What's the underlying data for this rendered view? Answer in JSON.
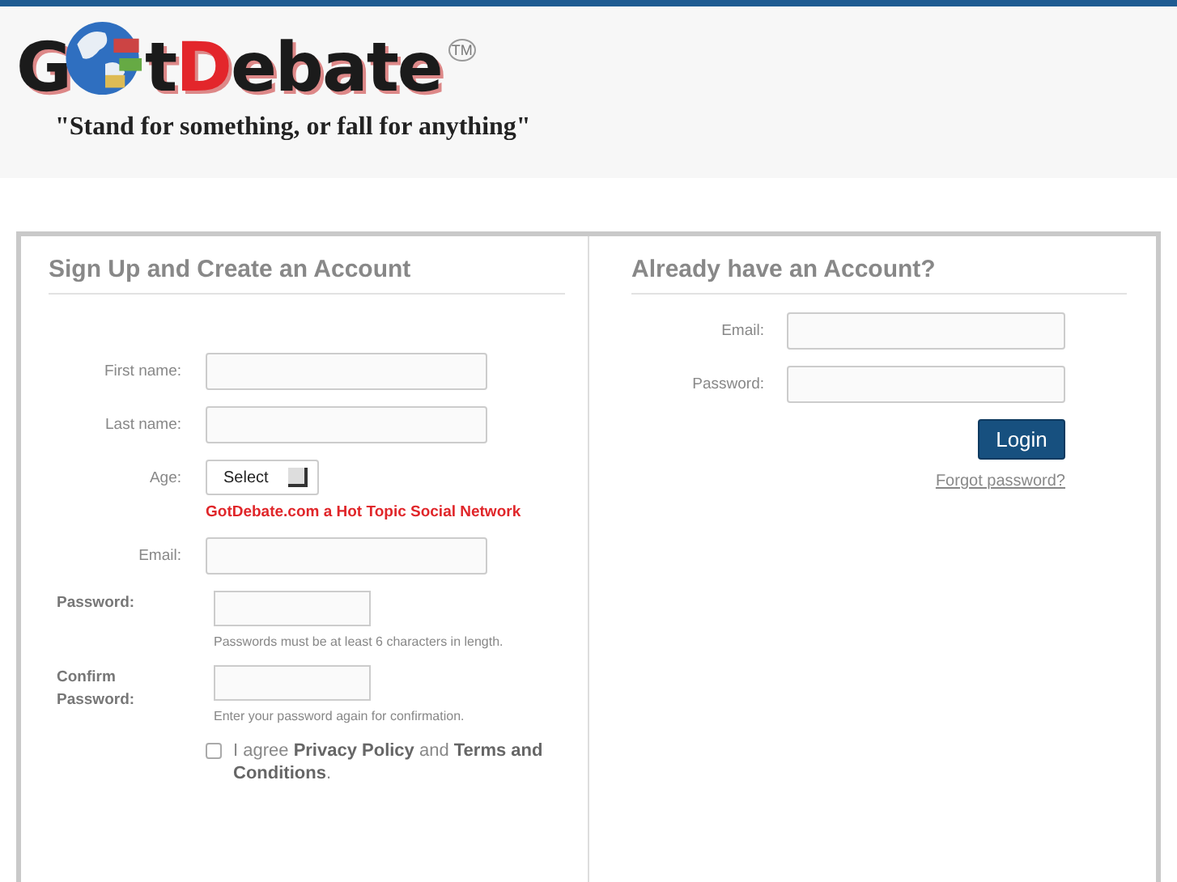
{
  "header": {
    "logo": {
      "first": "G",
      "second": "t",
      "accent": "D",
      "rest": "ebate",
      "trademark": "TM"
    },
    "tagline": "\"Stand for something, or fall for anything\""
  },
  "signup": {
    "title": "Sign Up and Create an Account",
    "fields": [
      {
        "kind": "text",
        "label": "First name:",
        "strong": false
      },
      {
        "kind": "text",
        "label": "Last name:",
        "strong": false
      },
      {
        "kind": "select",
        "label": "Age:",
        "strong": false,
        "value": "Select",
        "note": "GotDebate.com a Hot Topic Social Network"
      },
      {
        "kind": "text",
        "label": "Email:",
        "strong": false
      },
      {
        "kind": "short",
        "label": "Password:",
        "strong": true,
        "hint": "Passwords must be at least 6 characters in length."
      },
      {
        "kind": "short",
        "label": "Confirm Password:",
        "strong": true,
        "hint": "Enter your password again for confirmation."
      }
    ],
    "agree": {
      "checked": false,
      "text": "I agree **Privacy Policy** and **Terms and Conditions**."
    }
  },
  "login": {
    "title": "Already have an Account?",
    "fields": [
      {
        "label": "Email:"
      },
      {
        "label": "Password:"
      }
    ],
    "button": "Login",
    "forgot": "Forgot password?"
  }
}
